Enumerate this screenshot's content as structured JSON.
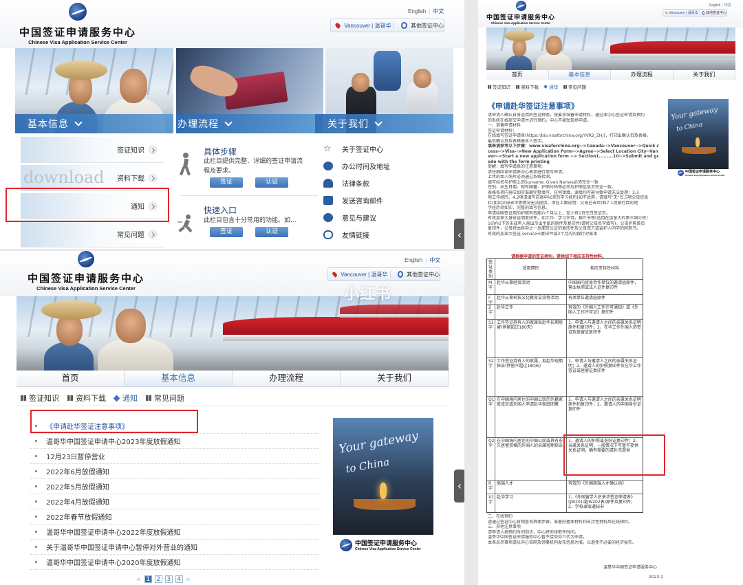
{
  "logo": {
    "cn": "中国签证申请服务中心",
    "en": "Chinese Visa Application Service Center"
  },
  "lang": {
    "english": "English",
    "chinese": "中文"
  },
  "location": {
    "city": "Vancouver | 温哥华",
    "other": "其他签证中心"
  },
  "panel1": {
    "sections": [
      "基本信息",
      "办理流程",
      "关于我们"
    ],
    "basic_rows": [
      "签证知识",
      "资料下载",
      "通知",
      "常见问题"
    ],
    "download_art": "download",
    "steps": [
      {
        "title": "具体步骤",
        "text": "此栏目提供完整、详细的签证申请流程及要求。",
        "buttons": [
          "签证",
          "认证"
        ]
      },
      {
        "title": "快速入口",
        "text": "此栏目包含十分常用的功能。如...",
        "buttons": [
          "签证",
          "认证"
        ]
      }
    ],
    "about": [
      "关于签证中心",
      "办公时间及地址",
      "法律条款",
      "发送咨询邮件",
      "意见与建议",
      "友情链接"
    ]
  },
  "panel2": {
    "tabs": [
      "首页",
      "基本信息",
      "办理流程",
      "关于我们"
    ],
    "subnav": [
      "签证知识",
      "资料下载",
      "通知",
      "常见问题"
    ]
  },
  "panel3": {
    "tabs": [
      "首页",
      "基本信息",
      "办理流程",
      "关于我们"
    ],
    "subnav": [
      "签证知识",
      "资料下载",
      "通知",
      "常见问题"
    ],
    "notices": [
      "《申请赴华签证注意事项》",
      "温哥华中国签证申请中心2023年度放假通知",
      "12月23日暂停营业",
      "2022年6月放假通知",
      "2022年5月放假通知",
      "2022年4月放假通知",
      "2022年春节放假通知",
      "温哥华中国签证申请中心2022年度放假通知",
      "关于温哥华中国签证申请中心暂停对外营业的通知",
      "温哥华中国签证申请中心2020年度放假通知"
    ],
    "pages": [
      "1",
      "2",
      "3",
      "4"
    ],
    "pager_prev": "«",
    "pager_next": "»",
    "poster": [
      "Your gateway",
      "to China"
    ]
  },
  "panel4": {
    "doc_title": "《申请赴华签证注意事项》",
    "body_lines": [
      "请申请人确认自身适用的签证种类，按要求准备申请材料，通过本中心签证申请及预约",
      "的系统在线提交申请并进行预约，中心不接受现场申请。",
      "一、准备申请材料",
      "签证申请材料：",
      "在线填写签证申请表(https://bio.visaforchina.org/YVR2_ZH/)，打印出确认页及表格，",
      "最后确认页及表格需本人签字。",
      "填表请参考以下步骤：www.visaforchina.org-->Canada-->Vancouver-->Quick Ac",
      "cess-->Visa-->New Application Form-->Agree-->Select Location City--Vancou",
      "ver-->Start a new application form -->  Section1.........10-->Submit and get a barc",
      "ode with the form printing",
      "提醒：填写申请表的注意事项:",
      "请仔细阅读申请表中心表项进行填写申请。",
      "上传的本人照片必须通过系统检测。",
      "填写姓名与护照上的Surname, Given Names必须完全一致",
      "性别、出生日期、现有国籍、护照号码等必须与护照信息页完全一致。",
      "表格各项内容应如实准确完整填写，任何错填、漏填均可能导致申请无法受理：3.3",
      "项工作经历、4.2项请填写自高中以来的学习经历(如不适用，请填写\"无\")5.5项父母信息",
      "栏(如因父母去世等情况无法提供，须在上面说明：父母已去世)和7.1项旅行目的地",
      "学经历须如实、完整的填写信息。",
      "申请中国签证用的护照有效期六个月以上，至少有1页空白签证页。",
      "有效加拿大身份证明复印件，如工作、学习许可，枫叶卡等(适用在加拿大的第三国公民)",
      "16岁以下的未成年人需出示出生纸的原件及复印件(请将父母名字填写)，父母护照首页",
      "复印件，父母将由其中之一反面签公证的复印件及父母双方或监护人同学的同意书。",
      "有效的加拿大签证 service卡复印件或3个月内的银行对账单"
    ],
    "table_caption": "请根据申请的签证类别，提供如下相应支持性材料。",
    "table_headers": [
      "签证类别",
      "适用情形",
      "相应支持性材料"
    ],
    "table_rows": [
      [
        "M字",
        "赴华从事经贸活动",
        "中国国内贸易合作单位的邀请函原件，营业执照或法人证件复印件"
      ],
      [
        "F字",
        "赴华从事科技文化教育交流等活动",
        "有关单位邀请函原件"
      ],
      [
        "Z字",
        "赴华工作",
        "有效的《外国人工作许可通知》或《外国人工作许可证》复印件"
      ],
      [
        "S1字",
        "工作签证持有人的家属拟赴华长期居留(停留超过180天)",
        "1、申请人与邀请人之间的亲属关系证明原件和复印件；2、在华工作外国人的签证及居留证复印件"
      ],
      [
        "S2字",
        "工作签证持有人的家属，拟赴华短期探亲(停留不超过180天)",
        "1、申请人与邀请人之间的亲属关系证明；2、邀请人的护照复印件及在华工作签证或居留证复印件"
      ],
      [
        "Q1字",
        "在中国境内居住的中国公民的外籍家庭成员或外国人申请赴华家庭团聚",
        "1、申请人与邀请人之间的亲属关系证明原件和复印件；2、邀请人的中国身份证复印件"
      ],
      [
        "Q2字",
        "在中国境内居住的中国公民或具有永久居留资格的外国人的亲属短期探亲",
        "1、邀请人的护照或身份证复印件；2、亲属关系证明，一般情况下可暂不提供关系证明，确有需要的请补充提供"
      ],
      [
        "R字",
        "高端人才",
        "有效的《外国高端人才确认函》"
      ],
      [
        "X1字",
        "赴华学习",
        "1、《外国留学人员来华签证申请表》(JW201或JW202表)原件及复印件；2、学校录取通知书"
      ]
    ],
    "tail_lines": [
      "二、在线预约",
      "请通过签证中心官网查询具体步骤，准备好基本材料和支持性材料后在线预约。",
      "三、其他注意事项",
      "请申请人按预约时间到访，中心将安排取件时间。",
      "温哥华中国签证申请服务中心暂不接受中介代为申请。",
      "本表未尽事项请以中心官网及领事机构发布信息为准，以避免不必要的经济损失。"
    ],
    "signature": "温哥华中国签证申请服务中心",
    "date": "2023.2"
  },
  "watermark": "小红书",
  "colors": {
    "brand_blue": "#2f6cb3",
    "dark_blue": "#1b3f83",
    "red_box": "#e0252e"
  }
}
